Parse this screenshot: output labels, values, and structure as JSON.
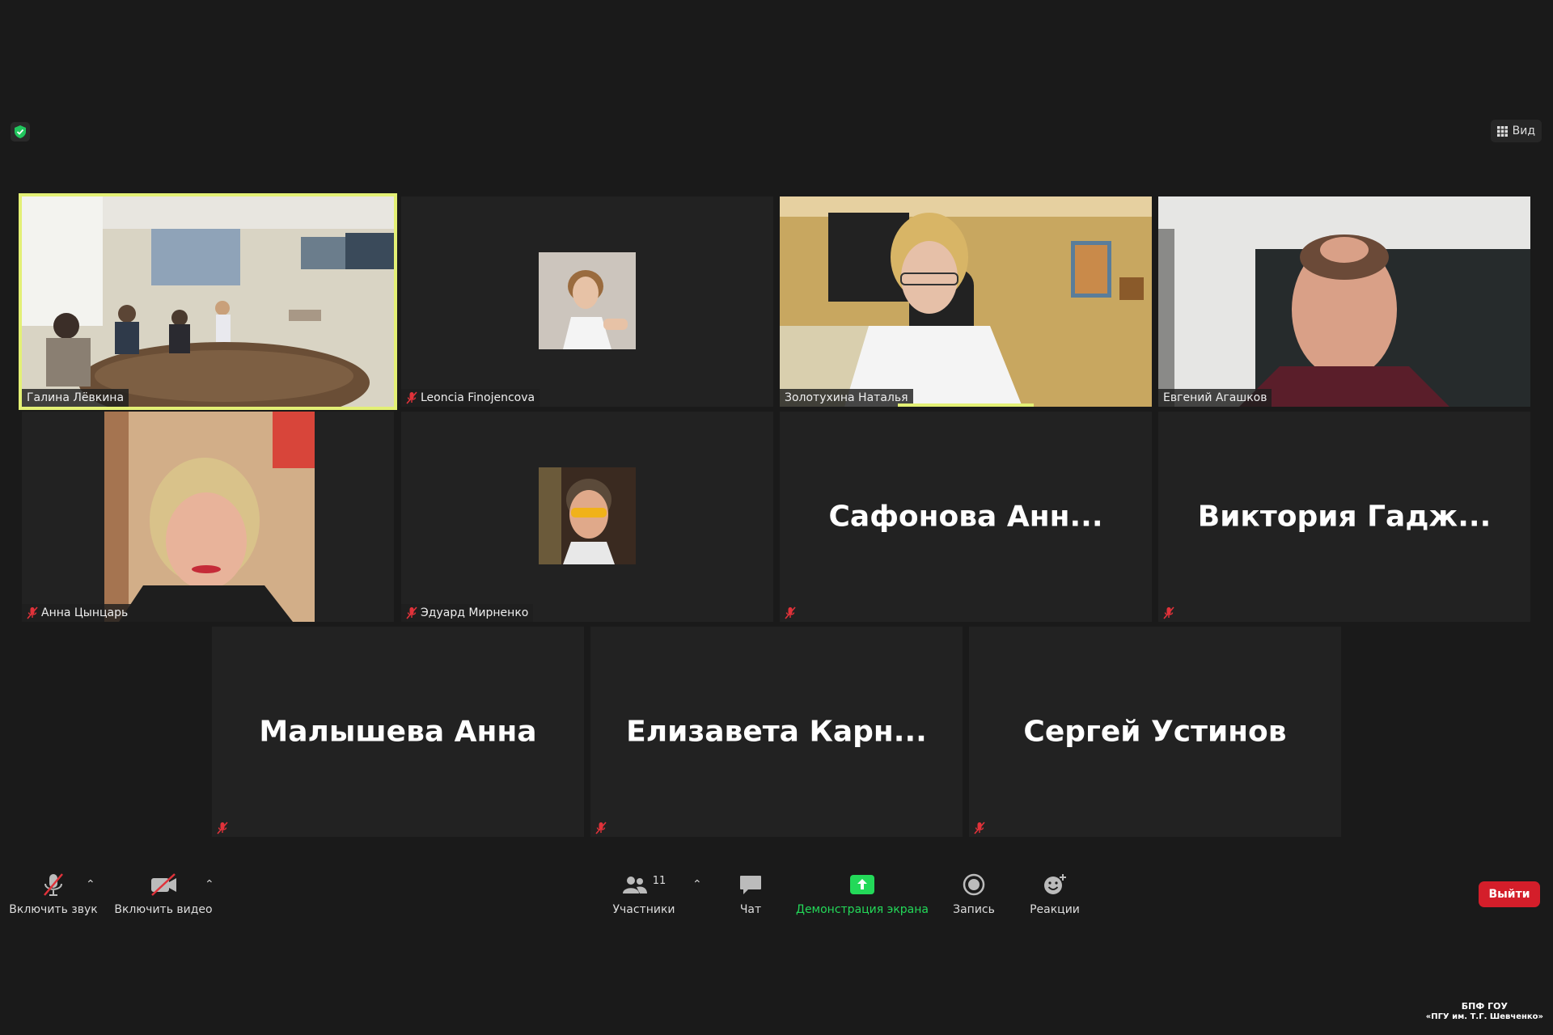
{
  "header": {
    "view_label": "Вид",
    "view_icon": "grid-icon",
    "security_icon": "shield-check-icon",
    "security_color": "#21c55d"
  },
  "tiles": [
    {
      "name": "Галина Лёвкина",
      "muted": false,
      "video": true,
      "active": true
    },
    {
      "name": "Leoncia Finojencova",
      "muted": true,
      "video": false,
      "avatar": true
    },
    {
      "name": "Золотухина Наталья",
      "muted": false,
      "video": true
    },
    {
      "name": "Евгений Агашков",
      "muted": false,
      "video": true
    },
    {
      "name": "Анна Цынцарь",
      "muted": true,
      "video": true
    },
    {
      "name": "Эдуард Мирненко",
      "muted": true,
      "video": false,
      "avatar": true
    },
    {
      "name": "Сафонова  Анн...",
      "muted": true,
      "video": false
    },
    {
      "name": "Виктория  Гадж...",
      "muted": true,
      "video": false
    },
    {
      "name": "Малышева Анна",
      "muted": true,
      "video": false
    },
    {
      "name": "Елизавета  Карн...",
      "muted": true,
      "video": false
    },
    {
      "name": "Сергей Устинов",
      "muted": true,
      "video": false
    }
  ],
  "toolbar": {
    "audio_label": "Включить звук",
    "video_label": "Включить видео",
    "participants_label": "Участники",
    "participants_count": "11",
    "chat_label": "Чат",
    "share_label": "Демонстрация экрана",
    "record_label": "Запись",
    "reactions_label": "Реакции",
    "leave_label": "Выйти",
    "share_color": "#23d959",
    "leave_color": "#d41e2a",
    "muted_color": "#e0323a"
  },
  "watermark": {
    "line1": "БПФ ГОУ",
    "line2": "«ПГУ им. Т.Г. Шевченко»"
  }
}
